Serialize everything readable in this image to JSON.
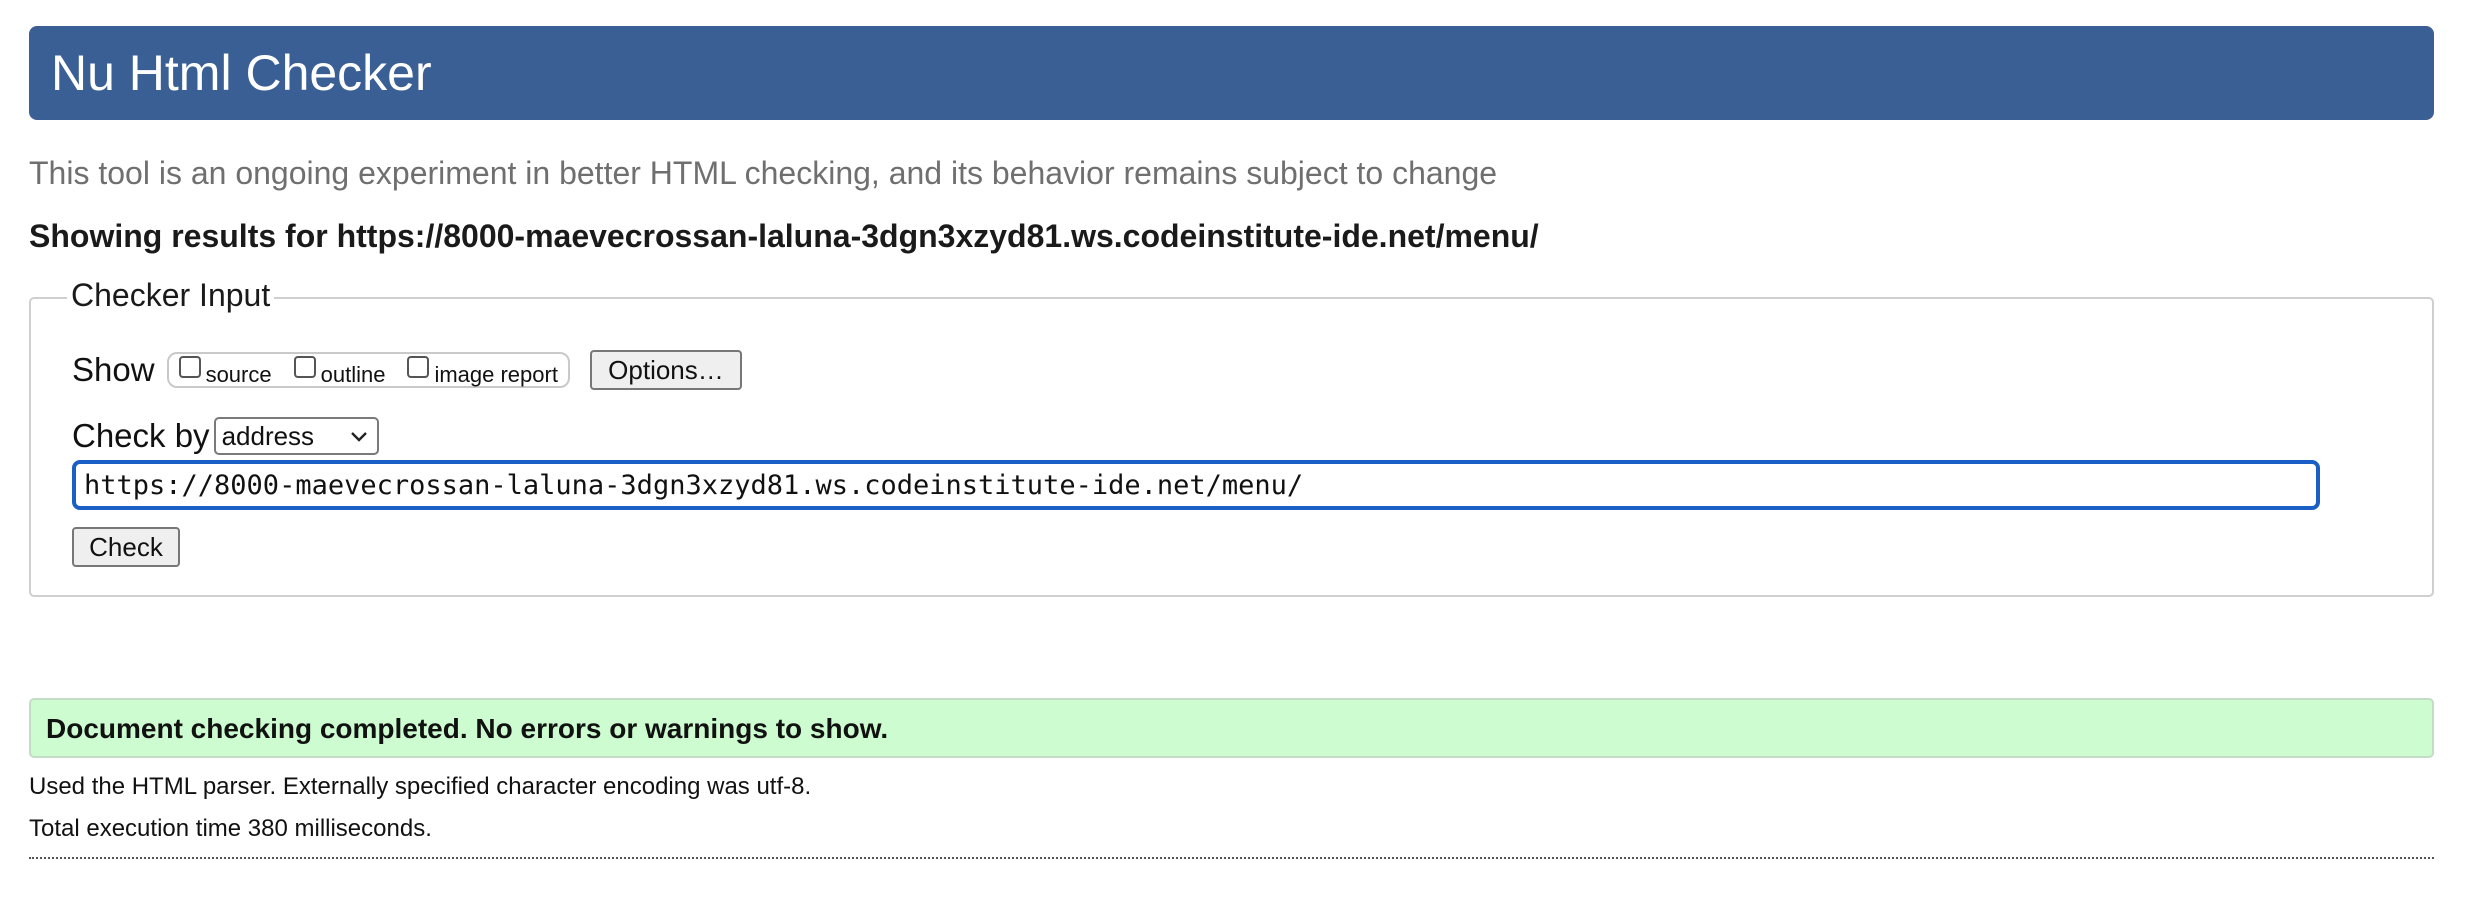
{
  "header": {
    "title": "Nu Html Checker"
  },
  "intro": {
    "subtitle": "This tool is an ongoing experiment in better HTML checking, and its behavior remains subject to change",
    "results_for": "Showing results for https://8000-maevecrossan-laluna-3dgn3xzyd81.ws.codeinstitute-ide.net/menu/"
  },
  "checker_input": {
    "legend": "Checker Input",
    "show_label": "Show",
    "show_options": [
      {
        "label": "source",
        "checked": false
      },
      {
        "label": "outline",
        "checked": false
      },
      {
        "label": "image report",
        "checked": false
      }
    ],
    "options_button": "Options…",
    "check_by_label": "Check by",
    "check_by_selected": "address",
    "url_value": "https://8000-maevecrossan-laluna-3dgn3xzyd81.ws.codeinstitute-ide.net/menu/",
    "check_button": "Check"
  },
  "results": {
    "success_message": "Document checking completed. No errors or warnings to show.",
    "parser_info": "Used the HTML parser. Externally specified character encoding was utf-8.",
    "execution_time": "Total execution time 380 milliseconds."
  },
  "colors": {
    "header_bg": "#3a5f95",
    "success_bg": "#ccfcd0",
    "input_focus": "#1a5fc6",
    "subtitle_text": "#6f6f6f"
  },
  "icons": {
    "select_arrow": "chevron-down-icon"
  }
}
